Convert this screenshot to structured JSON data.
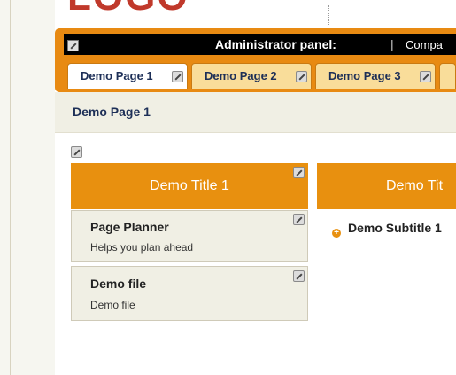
{
  "logo_text": "LOGO",
  "admin": {
    "title": "Administrator panel:",
    "separator": "|",
    "company": "Compa"
  },
  "tabs": [
    {
      "label": "Demo Page 1",
      "active": true
    },
    {
      "label": "Demo Page 2",
      "active": false
    },
    {
      "label": "Demo Page 3",
      "active": false
    }
  ],
  "page_title": "Demo Page 1",
  "panels": [
    {
      "title": "Demo Title 1",
      "items": [
        {
          "title": "Page Planner",
          "subtitle": "Helps you plan ahead"
        },
        {
          "title": "Demo file",
          "subtitle": "Demo file"
        }
      ]
    },
    {
      "title": "Demo Tit",
      "items": [
        {
          "title": "Demo Subtitle 1",
          "bullet": "+"
        }
      ]
    }
  ],
  "colors": {
    "accent": "#e8900f",
    "admin_bar": "#000000",
    "tab_inactive": "#f9dd9a",
    "heading_text": "#1d2f57",
    "card_bg": "#f0efe4"
  }
}
